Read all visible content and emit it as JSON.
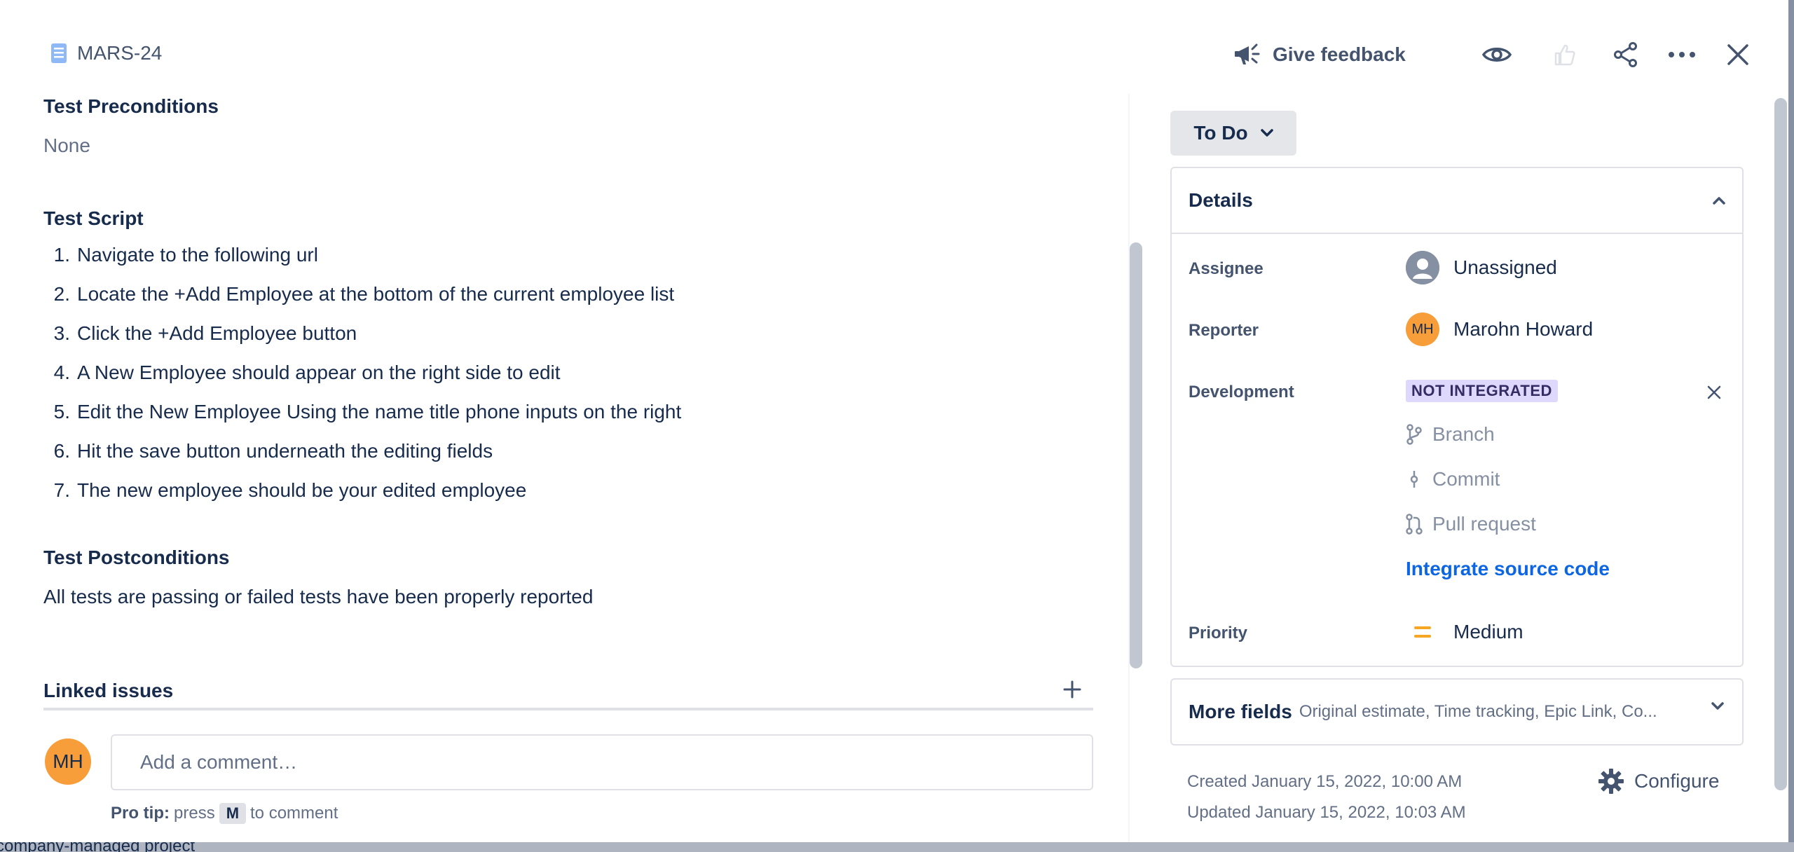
{
  "header": {
    "issue_key": "MARS-24",
    "feedback_label": "Give feedback"
  },
  "content": {
    "preconditions_title": "Test Preconditions",
    "preconditions_value": "None",
    "script_title": "Test Script",
    "steps": [
      "Navigate to the following url",
      "Locate the +Add Employee at the bottom of the current employee list",
      "Click the +Add Employee button",
      "A New Employee should appear on the right side to edit",
      "Edit the New Employee Using the name title phone inputs on the right",
      "Hit the save button underneath the editing fields",
      "The new employee should be your edited employee"
    ],
    "step_numbers": [
      "1.",
      "2.",
      "3.",
      "4.",
      "5.",
      "6.",
      "7."
    ],
    "postconditions_title": "Test Postconditions",
    "postconditions_value": "All tests are passing or failed tests have been properly reported",
    "linked_issues_title": "Linked issues"
  },
  "comment": {
    "avatar_initials": "MH",
    "placeholder": "Add a comment…",
    "protip_bold": "Pro tip:",
    "protip_pre": "press",
    "protip_key": "M",
    "protip_post": "to comment"
  },
  "status": {
    "label": "To Do"
  },
  "details": {
    "title": "Details",
    "assignee_label": "Assignee",
    "assignee_value": "Unassigned",
    "reporter_label": "Reporter",
    "reporter_initials": "MH",
    "reporter_value": "Marohn Howard",
    "development_label": "Development",
    "development_badge": "NOT INTEGRATED",
    "dev_branch": "Branch",
    "dev_commit": "Commit",
    "dev_pull_request": "Pull request",
    "integrate_link": "Integrate source code",
    "priority_label": "Priority",
    "priority_value": "Medium"
  },
  "more_fields": {
    "title": "More fields",
    "summary": "Original estimate, Time tracking, Epic Link, Co..."
  },
  "meta": {
    "created": "Created January 15, 2022, 10:00 AM",
    "updated": "Updated January 15, 2022, 10:03 AM",
    "configure_label": "Configure"
  },
  "footer": {
    "text": "company-managed project"
  },
  "colors": {
    "accent_link": "#0c66e4",
    "avatar_orange": "#f79e3b",
    "badge_bg": "#dfd8fd",
    "priority_medium": "#f5a623"
  }
}
